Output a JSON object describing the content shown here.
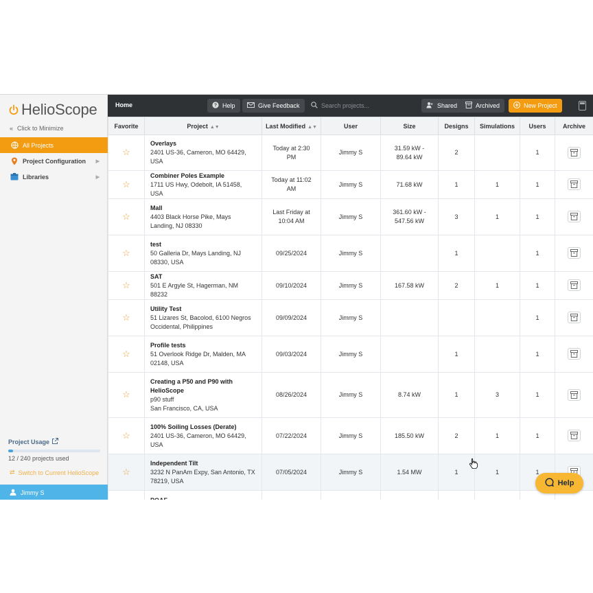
{
  "sidebar": {
    "logo_text": "HelioScope",
    "minimize_label": "Click to Minimize",
    "items": [
      {
        "label": "All Projects",
        "icon": "globe-icon"
      },
      {
        "label": "Project Configuration",
        "icon": "map-pin-icon"
      },
      {
        "label": "Libraries",
        "icon": "library-icon"
      }
    ],
    "usage_title": "Project Usage",
    "usage_text": "12 / 240 projects used",
    "usage_fraction": 0.05,
    "switch_label": "Switch to Current HelioScope",
    "user_name": "Jimmy S"
  },
  "topbar": {
    "home_label": "Home",
    "help_label": "Help",
    "feedback_label": "Give Feedback",
    "search_placeholder": "Search projects...",
    "shared_label": "Shared",
    "archived_label": "Archived",
    "new_project_label": "New Project"
  },
  "table": {
    "headers": [
      "Favorite",
      "Project",
      "Last Modified",
      "User",
      "Size",
      "Designs",
      "Simulations",
      "Users",
      "Archive"
    ],
    "rows": [
      {
        "name": "Overlays",
        "address": "2401 US-36, Cameron, MO 64429, USA",
        "modified": "Today at 2:30 PM",
        "user": "Jimmy S",
        "size": "31.59 kW - 89.64 kW",
        "designs": "2",
        "simulations": "",
        "users": "1"
      },
      {
        "name": "Combiner Poles Example",
        "address": "1711 US Hwy, Odebolt, IA 51458, USA",
        "modified": "Today at 11:02 AM",
        "user": "Jimmy S",
        "size": "71.68 kW",
        "designs": "1",
        "simulations": "1",
        "users": "1"
      },
      {
        "name": "Mall",
        "address": "4403 Black Horse Pike, Mays Landing, NJ 08330",
        "modified": "Last Friday at 10:04 AM",
        "user": "Jimmy S",
        "size": "361.60 kW - 547.56 kW",
        "designs": "3",
        "simulations": "1",
        "users": "1"
      },
      {
        "name": "test",
        "address": "50 Galleria Dr, Mays Landing, NJ 08330, USA",
        "modified": "09/25/2024",
        "user": "Jimmy S",
        "size": "",
        "designs": "1",
        "simulations": "",
        "users": "1"
      },
      {
        "name": "SAT",
        "address": "501 E Argyle St, Hagerman, NM 88232",
        "modified": "09/10/2024",
        "user": "Jimmy S",
        "size": "167.58 kW",
        "designs": "2",
        "simulations": "1",
        "users": "1"
      },
      {
        "name": "Utility Test",
        "address": "51 Lizares St, Bacolod, 6100 Negros Occidental, Philippines",
        "modified": "09/09/2024",
        "user": "Jimmy S",
        "size": "",
        "designs": "",
        "simulations": "",
        "users": "1"
      },
      {
        "name": "Profile tests",
        "address": "51 Overlook Ridge Dr, Malden, MA 02148, USA",
        "modified": "09/03/2024",
        "user": "Jimmy S",
        "size": "",
        "designs": "1",
        "simulations": "",
        "users": "1"
      },
      {
        "name": "Creating a P50 and P90 with HelioScope",
        "note": "p90 stuff",
        "address": "San Francisco, CA, USA",
        "modified": "08/26/2024",
        "user": "Jimmy S",
        "size": "8.74 kW",
        "designs": "1",
        "simulations": "3",
        "users": "1"
      },
      {
        "name": "100% Soiling Losses (Derate)",
        "address": "2401 US-36, Cameron, MO 64429, USA",
        "modified": "07/22/2024",
        "user": "Jimmy S",
        "size": "185.50 kW",
        "designs": "2",
        "simulations": "1",
        "users": "1"
      },
      {
        "name": "Independent Tilt",
        "address": "3232 N PanAm Expy, San Antonio, TX 78219, USA",
        "modified": "07/05/2024",
        "user": "Jimmy S",
        "size": "1.54 MW",
        "designs": "1",
        "simulations": "1",
        "users": "1"
      },
      {
        "name": "POAF",
        "address": "",
        "modified": "",
        "user": "",
        "size": "",
        "designs": "",
        "simulations": "",
        "users": ""
      }
    ]
  },
  "help_fab_label": "Help",
  "colors": {
    "accent": "#f39c12",
    "topbar": "#2f3235",
    "user_bar": "#4fb5e8",
    "help_fab": "#f7b733"
  }
}
